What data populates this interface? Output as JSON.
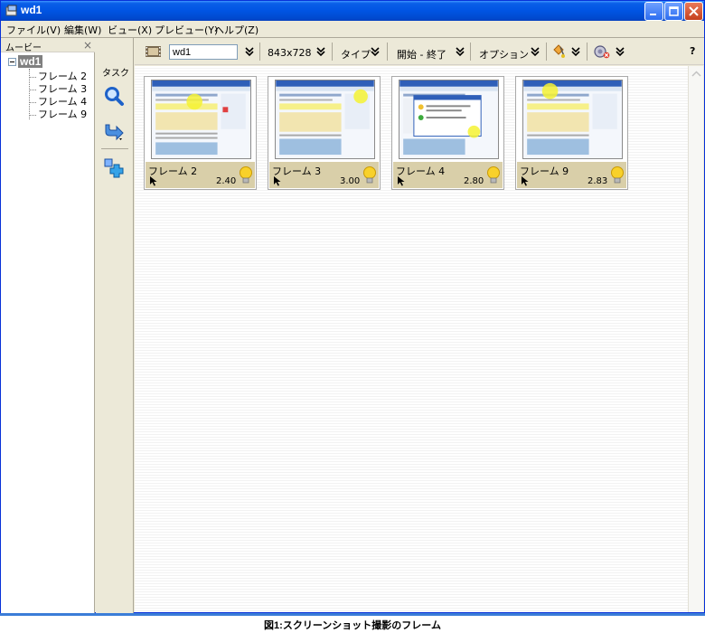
{
  "window": {
    "title": "wd1"
  },
  "menu": [
    {
      "label": "ファイル(V)"
    },
    {
      "label": "編集(W)"
    },
    {
      "label": "ビュー(X)"
    },
    {
      "label": "プレビュー(Y)"
    },
    {
      "label": "ヘルプ(Z)"
    }
  ],
  "tree": {
    "header": "ムービー",
    "root": "wd1",
    "items": [
      "フレーム 2",
      "フレーム 3",
      "フレーム 4",
      "フレーム 9"
    ]
  },
  "tasks": {
    "label": "タスク",
    "icons": [
      "magnifier-icon",
      "export-arrow-icon",
      "add-frame-icon"
    ]
  },
  "toolbar": {
    "movie_name": "wd1",
    "size": "843x728",
    "type_label": "タイプ",
    "start_end_label": "開始 - 終了",
    "options_label": "オプション",
    "help_label": "?"
  },
  "frames": [
    {
      "name": "フレーム 2",
      "duration": "2.40"
    },
    {
      "name": "フレーム 3",
      "duration": "3.00"
    },
    {
      "name": "フレーム 4",
      "duration": "2.80"
    },
    {
      "name": "フレーム 9",
      "duration": "2.83"
    }
  ],
  "caption": "図1:スクリーンショット撮影のフレーム",
  "colors": {
    "titlebar": "#0054e3",
    "frame_footer": "#d9cfa9",
    "window_face": "#ece9d8"
  }
}
